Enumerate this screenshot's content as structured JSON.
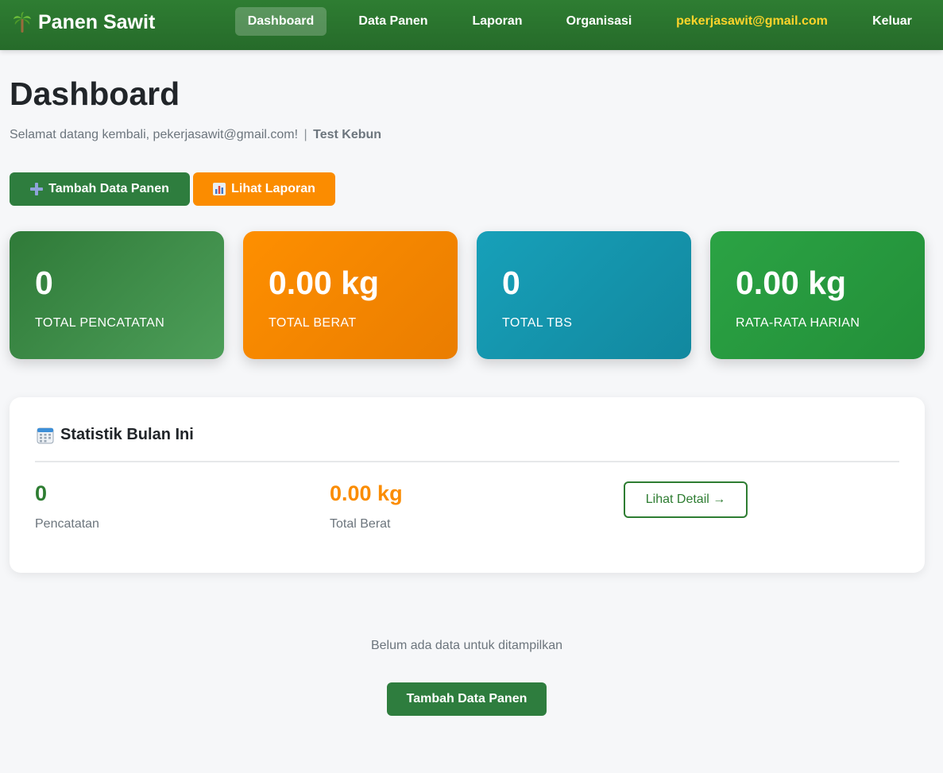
{
  "navbar": {
    "brand": "Panen Sawit",
    "brand_icon": "palm-tree-icon",
    "links": [
      {
        "label": "Dashboard",
        "active": true
      },
      {
        "label": "Data Panen",
        "active": false
      },
      {
        "label": "Laporan",
        "active": false
      },
      {
        "label": "Organisasi",
        "active": false
      }
    ],
    "user_email": "pekerjasawit@gmail.com",
    "logout_label": "Keluar"
  },
  "header": {
    "title": "Dashboard",
    "welcome_text": "Selamat datang kembali, pekerjasawit@gmail.com!",
    "separator": "|",
    "organization": "Test Kebun"
  },
  "actions": {
    "add_label": "Tambah Data Panen",
    "add_icon": "plus-icon",
    "report_label": "Lihat Laporan",
    "report_icon": "bar-chart-icon"
  },
  "stats": [
    {
      "value": "0",
      "label": "TOTAL PENCATATAN",
      "color": "#2f7a38"
    },
    {
      "value": "0.00 kg",
      "label": "TOTAL BERAT",
      "color": "#fb8c00"
    },
    {
      "value": "0",
      "label": "TOTAL TBS",
      "color": "#17a0b9"
    },
    {
      "value": "0.00 kg",
      "label": "RATA-RATA HARIAN",
      "color": "#28a745"
    }
  ],
  "monthly": {
    "title": "Statistik Bulan Ini",
    "icon": "calendar-icon",
    "records_value": "0",
    "records_label": "Pencatatan",
    "weight_value": "0.00 kg",
    "weight_label": "Total Berat",
    "detail_label": "Lihat Detail →",
    "records_color": "#2e7d32",
    "weight_color": "#fb8c00"
  },
  "empty_state": {
    "message": "Belum ada data untuk ditampilkan",
    "button_label": "Tambah Data Panen"
  }
}
